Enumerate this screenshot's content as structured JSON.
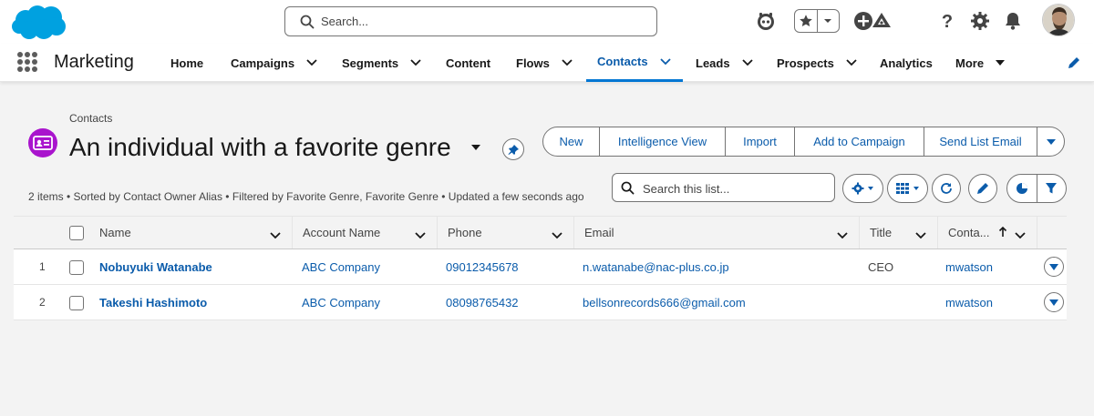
{
  "header": {
    "search_placeholder": "Search..."
  },
  "nav": {
    "app_name": "Marketing",
    "items": [
      {
        "label": "Home"
      },
      {
        "label": "Campaigns"
      },
      {
        "label": "Segments"
      },
      {
        "label": "Content"
      },
      {
        "label": "Flows"
      },
      {
        "label": "Contacts"
      },
      {
        "label": "Leads"
      },
      {
        "label": "Prospects"
      },
      {
        "label": "Analytics"
      },
      {
        "label": "More"
      }
    ],
    "active_item": "Contacts"
  },
  "page": {
    "breadcrumb": "Contacts",
    "title": "An individual with a favorite genre",
    "meta": "2 items • Sorted by Contact Owner Alias • Filtered by Favorite Genre, Favorite Genre • Updated a few seconds ago",
    "actions": [
      "New",
      "Intelligence View",
      "Import",
      "Add to Campaign",
      "Send List Email"
    ],
    "list_search_placeholder": "Search this list..."
  },
  "table": {
    "columns": [
      "Name",
      "Account Name",
      "Phone",
      "Email",
      "Title",
      "Conta..."
    ],
    "rows": [
      {
        "num": "1",
        "name": "Nobuyuki Watanabe",
        "account": "ABC Company",
        "phone": "09012345678",
        "email": "n.watanabe@nac-plus.co.jp",
        "title": "CEO",
        "owner": "mwatson"
      },
      {
        "num": "2",
        "name": "Takeshi Hashimoto",
        "account": "ABC Company",
        "phone": "08098765432",
        "email": "bellsonrecords666@gmail.com",
        "title": "",
        "owner": "mwatson"
      }
    ]
  },
  "colors": {
    "brand_blue": "#0176d3",
    "link_blue": "#0b5cab",
    "contact_icon": "#a914cd",
    "logo_blue": "#00a1e0"
  },
  "icons": {
    "global_header": [
      "salesforce-cloud-logo",
      "search-icon",
      "agent-icon",
      "favorites-star-icon",
      "chevron-down-icon",
      "add-icon",
      "trailhead-icon",
      "help-icon",
      "setup-gear-icon",
      "notifications-bell-icon",
      "user-avatar"
    ],
    "list_toolbar": [
      "settings-gear-icon",
      "table-view-icon",
      "refresh-icon",
      "edit-pencil-icon",
      "chart-icon",
      "filter-icon"
    ]
  }
}
